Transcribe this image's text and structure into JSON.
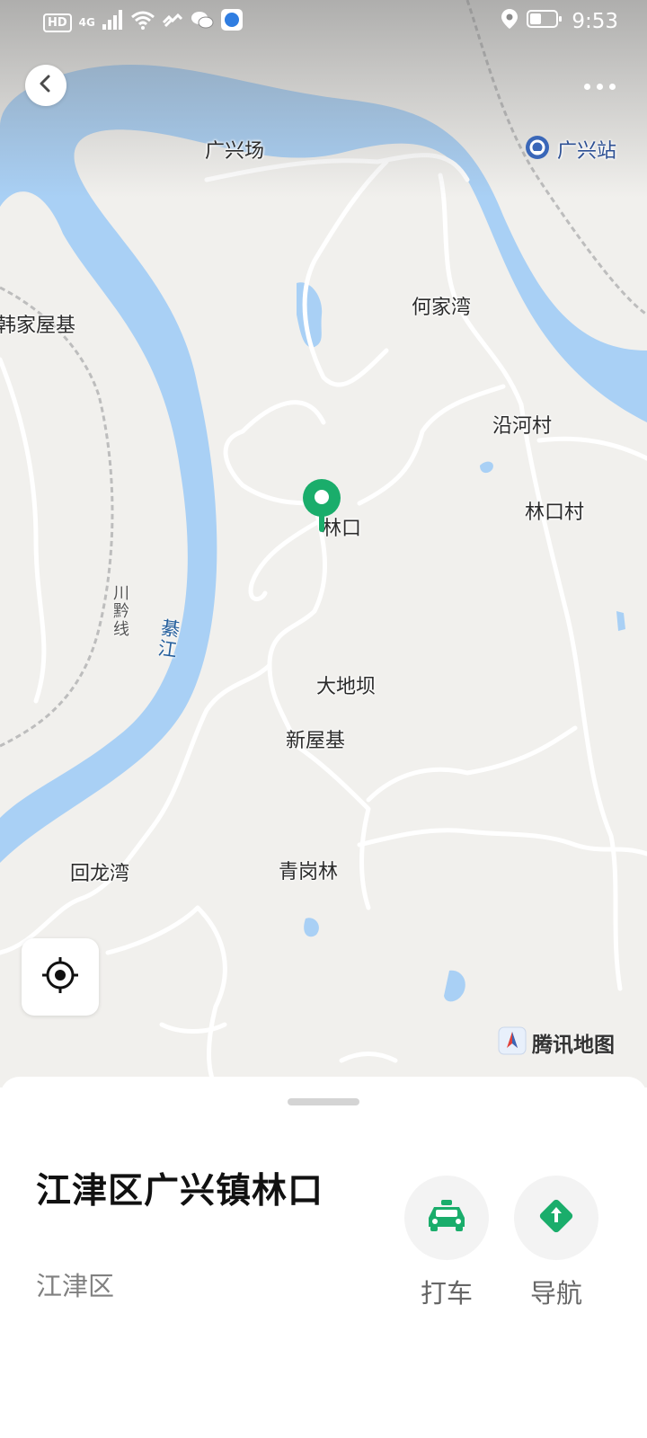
{
  "status_bar": {
    "hd": "HD",
    "network": "4G",
    "time": "9:53"
  },
  "nav": {
    "back_icon": "chevron-left-icon",
    "more_icon": "more-dots-icon"
  },
  "map": {
    "labels": {
      "guangxingchang": "广兴场",
      "guangxingzhan": "广兴站",
      "hejiawan": "何家湾",
      "hanjiawuji": "韩家屋基",
      "yanhecun": "沿河村",
      "linkou": "林口",
      "linkoucun": "林口村",
      "chuanqianxian": "川黔线",
      "qijiang": "綦江",
      "dadiba": "大地坝",
      "xinwuji": "新屋基",
      "huilongwan": "回龙湾",
      "qinggangl": "青岗林"
    },
    "attribution": "腾讯地图",
    "colors": {
      "water": "#a9d0f5",
      "land": "#f1f0ed",
      "pin": "#1aad6b"
    }
  },
  "place": {
    "title": "江津区广兴镇林口",
    "subtitle": "江津区"
  },
  "actions": {
    "taxi_label": "打车",
    "navigate_label": "导航",
    "accent": "#1aad6b"
  }
}
